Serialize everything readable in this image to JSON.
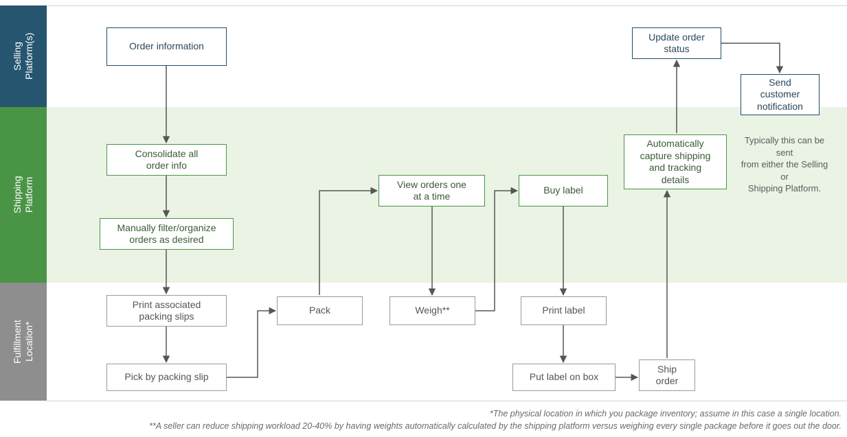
{
  "lanes": {
    "selling": "Selling\nPlatform(s)",
    "shipping": "Shipping\nPlatform",
    "fulfillment": "Fulfillment\nLocation*"
  },
  "boxes": {
    "order_info": "Order information",
    "consolidate": "Consolidate all\norder info",
    "filter": "Manually filter/organize\norders as desired",
    "print_slips": "Print associated\npacking slips",
    "pick": "Pick by packing slip",
    "pack": "Pack",
    "view_orders": "View orders one\nat a time",
    "weigh": "Weigh**",
    "buy_label": "Buy label",
    "print_label": "Print label",
    "put_label": "Put label on box",
    "ship": "Ship\norder",
    "capture": "Automatically\ncapture shipping\nand tracking\ndetails",
    "update_status": "Update order\nstatus",
    "send_notification": "Send\ncustomer\nnotification"
  },
  "note": "Typically this can be sent\nfrom either the Selling or\nShipping Platform.",
  "footnotes": {
    "a": "*The physical location in which you package inventory; assume in this case a single location.",
    "b": "**A seller can reduce shipping workload 20-40% by having weights automatically calculated by the shipping platform versus weighing every single package before it goes out the door."
  }
}
